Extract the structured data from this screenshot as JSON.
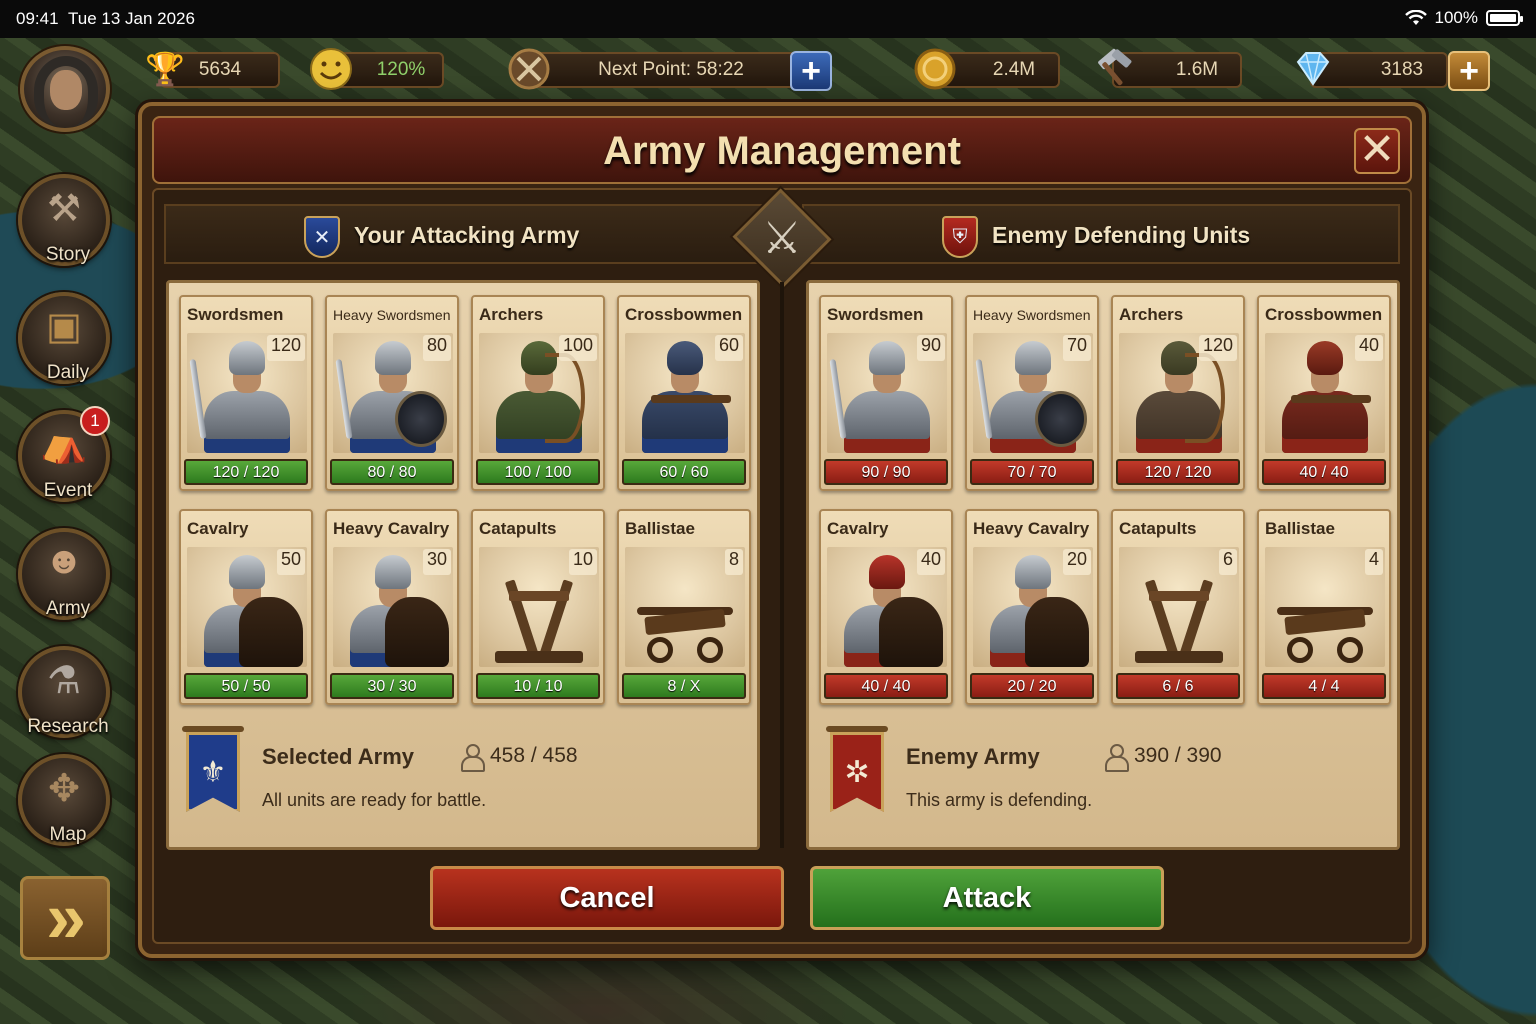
{
  "status_bar": {
    "time": "09:41",
    "date": "Tue 13 Jan 2026",
    "battery": "100%"
  },
  "top_bar": {
    "trophies": "5634",
    "happiness": "120%",
    "next_point": "Next Point: 58:22",
    "coins": "2.4M",
    "supplies": "1.6M",
    "diamonds": "3183"
  },
  "side_nav": {
    "items": [
      {
        "label": "Story",
        "icon": "hammer-icon"
      },
      {
        "label": "Daily",
        "icon": "chest-icon"
      },
      {
        "label": "Event",
        "icon": "tent-icon",
        "badge": "1"
      },
      {
        "label": "Army",
        "icon": "character-icon"
      },
      {
        "label": "Research",
        "icon": "flask-icon"
      },
      {
        "label": "Map",
        "icon": "map-icon"
      }
    ],
    "forward": "»"
  },
  "dialog": {
    "title": "Army Management",
    "close": "✕",
    "attacking_title": "Your Attacking Army",
    "defending_title": "Enemy Defending Units",
    "colors": {
      "player": "#2d7a1e",
      "enemy": "#8a1d14",
      "player_banner": "#1f3c8a",
      "enemy_banner": "#9a2218"
    },
    "attack_units": [
      {
        "name": "Swordsmen",
        "count": "120",
        "status": "120 / 120"
      },
      {
        "name": "Heavy Swordsmen",
        "count": "80",
        "status": "80 / 80"
      },
      {
        "name": "Archers",
        "count": "100",
        "status": "100 / 100"
      },
      {
        "name": "Crossbowmen",
        "count": "60",
        "status": "60 / 60"
      },
      {
        "name": "Cavalry",
        "count": "50",
        "status": "50 / 50"
      },
      {
        "name": "Heavy Cavalry",
        "count": "30",
        "status": "30 / 30"
      },
      {
        "name": "Catapults",
        "count": "10",
        "status": "10 / 10"
      },
      {
        "name": "Ballistae",
        "count": "8",
        "status": "8 / X"
      }
    ],
    "enemy_units": [
      {
        "name": "Swordsmen",
        "count": "90",
        "status": "90 / 90"
      },
      {
        "name": "Heavy Swordsmen",
        "count": "70",
        "status": "70 / 70"
      },
      {
        "name": "Archers",
        "count": "120",
        "status": "120 / 120"
      },
      {
        "name": "Crossbowmen",
        "count": "40",
        "status": "40 / 40"
      },
      {
        "name": "Cavalry",
        "count": "40",
        "status": "40 / 40"
      },
      {
        "name": "Heavy Cavalry",
        "count": "20",
        "status": "20 / 20"
      },
      {
        "name": "Catapults",
        "count": "6",
        "status": "6 / 6"
      },
      {
        "name": "Ballistae",
        "count": "4",
        "status": "4 / 4"
      }
    ],
    "attack_summary": {
      "title": "Selected Army",
      "population": "458 / 458",
      "message": "All units are ready for battle."
    },
    "enemy_summary": {
      "title": "Enemy Army",
      "population": "390 / 390",
      "message": "This army is defending."
    },
    "cancel_label": "Cancel",
    "attack_label": "Attack"
  }
}
